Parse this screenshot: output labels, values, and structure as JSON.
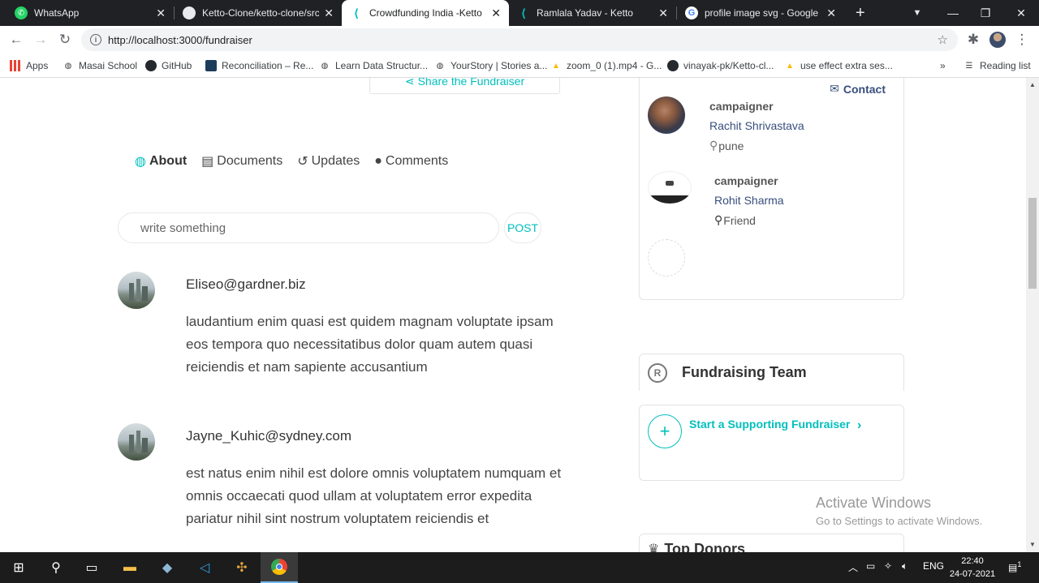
{
  "browser": {
    "tabs": [
      {
        "title": "WhatsApp",
        "icon": "whatsapp-icon"
      },
      {
        "title": "Ketto-Clone/ketto-clone/src/",
        "icon": "github-icon"
      },
      {
        "title": "Crowdfunding India -Ketto",
        "icon": "ketto-icon",
        "active": true
      },
      {
        "title": "Ramlala Yadav - Ketto",
        "icon": "ketto-icon"
      },
      {
        "title": "profile image svg - Google Se",
        "icon": "google-icon"
      }
    ],
    "url": "http://localhost:3000/fundraiser",
    "bookmarks": [
      {
        "label": "Apps",
        "icon": "apps-grid-icon"
      },
      {
        "label": "Masai School",
        "icon": "globe-icon"
      },
      {
        "label": "GitHub",
        "icon": "github-icon"
      },
      {
        "label": "Reconciliation – Re...",
        "icon": "app-icon"
      },
      {
        "label": "Learn Data Structur...",
        "icon": "globe-icon"
      },
      {
        "label": "YourStory | Stories a...",
        "icon": "globe-icon"
      },
      {
        "label": "zoom_0 (1).mp4 - G...",
        "icon": "drive-icon"
      },
      {
        "label": "vinayak-pk/Ketto-cl...",
        "icon": "github-icon"
      },
      {
        "label": "use effect extra ses...",
        "icon": "drive-icon"
      }
    ],
    "more_bookmarks": "»",
    "reading_list": "Reading list"
  },
  "page": {
    "share_label": "Share the Fundraiser",
    "tabs": [
      {
        "label": "About",
        "icon": "globe-icon",
        "active": true
      },
      {
        "label": "Documents",
        "icon": "document-icon"
      },
      {
        "label": "Updates",
        "icon": "history-icon"
      },
      {
        "label": "Comments",
        "icon": "comment-icon"
      }
    ],
    "comment_placeholder": "write something",
    "post_label": "POST",
    "comments": [
      {
        "email": "Eliseo@gardner.biz",
        "body": "laudantium enim quasi est quidem magnam voluptate ipsam eos tempora quo necessitatibus dolor quam autem quasi reiciendis et nam sapiente accusantium"
      },
      {
        "email": "Jayne_Kuhic@sydney.com",
        "body": "est natus enim nihil est dolore omnis voluptatem numquam et omnis occaecati quod ullam at voluptatem error expedita pariatur nihil sint nostrum voluptatem reiciendis et"
      }
    ]
  },
  "sidebar": {
    "contact_label": "Contact",
    "campaigners": [
      {
        "role": "campaigner",
        "name": "Rachit Shrivastava",
        "location": "pune"
      },
      {
        "role": "campaigner",
        "name": "Rohit Sharma",
        "location": "Friend"
      }
    ],
    "fundraising_team": "Fundraising Team",
    "support_label": "Start a Supporting Fundraiser",
    "top_donors": "Top Donors"
  },
  "watermark": {
    "line1": "Activate Windows",
    "line2": "Go to Settings to activate Windows."
  },
  "taskbar": {
    "language": "ENG",
    "time": "22:40",
    "date": "24-07-2021",
    "notification_count": "1"
  },
  "colors": {
    "accent": "#01bfbd",
    "link_navy": "#384f7d",
    "chrome_dark": "#202124",
    "taskbar": "#1c1c1c"
  }
}
